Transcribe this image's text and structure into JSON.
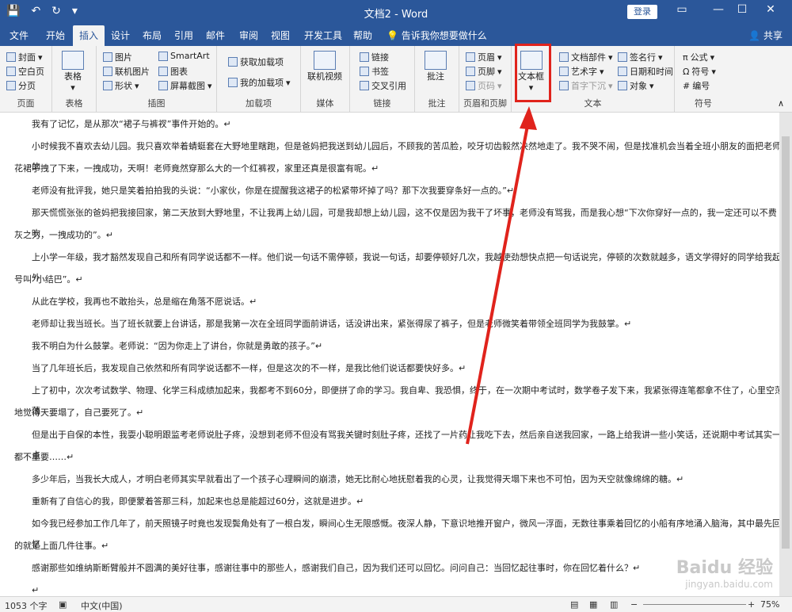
{
  "titlebar": {
    "title": "文档2 - Word",
    "login": "登录",
    "qat": [
      "💾",
      "↶",
      "↻",
      "▾"
    ],
    "min": "—",
    "max": "☐",
    "close": "✕"
  },
  "tabs": [
    "文件",
    "开始",
    "插入",
    "设计",
    "布局",
    "引用",
    "邮件",
    "审阅",
    "视图",
    "开发工具",
    "帮助"
  ],
  "active_tab": "插入",
  "tell_me": "告诉我你想要做什么",
  "share": "共享",
  "ribbon": {
    "pages": {
      "label": "页面",
      "items": [
        "封面",
        "空白页",
        "分页"
      ]
    },
    "tables": {
      "label": "表格",
      "items": [
        "表格"
      ]
    },
    "illustrations": {
      "label": "插图",
      "items": [
        "图片",
        "联机图片",
        "形状",
        "SmartArt",
        "图表",
        "屏幕截图"
      ]
    },
    "addins": {
      "label": "加载项",
      "items": [
        "获取加载项",
        "我的加载项"
      ]
    },
    "media": {
      "label": "媒体",
      "items": [
        "联机视频"
      ]
    },
    "links": {
      "label": "链接",
      "items": [
        "链接",
        "书签",
        "交叉引用"
      ]
    },
    "comments": {
      "label": "批注",
      "items": [
        "批注"
      ]
    },
    "headerfooter": {
      "label": "页眉和页脚",
      "items": [
        "页眉",
        "页脚",
        "页码"
      ]
    },
    "text": {
      "label": "文本",
      "items": [
        "文本框",
        "文档部件",
        "艺术字",
        "首字下沉",
        "签名行",
        "日期和时间",
        "对象"
      ]
    },
    "symbols": {
      "label": "符号",
      "items": [
        "公式",
        "符号",
        "编号"
      ]
    }
  },
  "document": {
    "paragraphs": [
      "我有了记忆，是从那次“裙子与裤衩”事件开始的。↵",
      "小时候我不喜欢去幼儿园。我只喜欢举着蜻蜓套在大野地里瞎跑，但是爸妈把我送到幼儿园后，不顾我的苦瓜脸，咬牙切齿毅然决然地走了。我不哭不闹，但是找准机会当着全班小朋友的面把老师的",
      "花裙子拽了下来，一拽成功，天啊！老师竟然穿那么大的一个红裤衩，家里还真是很富有呢。↵",
      "老师没有批评我，她只是笑着拍拍我的头说：“小家伙，你是在提醒我这裙子的松紧带坏掉了吗？那下次我要穿条好一点的。”↵",
      "那天慌慌张张的爸妈把我接回家，第二天放到大野地里，不让我再上幼儿园，可是我却想上幼儿园，这不仅是因为我干了坏事，老师没有骂我，而是我心想“下次你穿好一点的，我一定还可以不费吹",
      "灰之力，一拽成功的”。↵",
      "上小学一年级，我才豁然发现自己和所有同学说话都不一样。他们说一句话不需停顿，我说一句话，却要停顿好几次，我越使劲想快点把一句话说完，停顿的次数就越多，语文学得好的同学给我起外",
      "号叫“小结巴”。↵",
      "从此在学校，我再也不敢抬头，总是缩在角落不愿说话。↵",
      "老师却让我当班长。当了班长就要上台讲话，那是我第一次在全班同学面前讲话，话没讲出来，紧张得尿了裤子，但是老师微笑着带领全班同学为我鼓掌。↵",
      "我不明白为什么鼓掌。老师说：“因为你走上了讲台，你就是勇敢的孩子。”↵",
      "当了几年班长后，我发现自己依然和所有同学说话都不一样，但是这次的不一样，是我比他们说话都要快好多。↵",
      "上了初中，次次考试数学、物理、化学三科成绩加起来，我都考不到60分，即便拼了命的学习。我自卑、我恐惧，终于，在一次期中考试时，数学卷子发下来，我紧张得连笔都拿不住了，心里空荡荡",
      "地觉得天要塌了，自己要死了。↵",
      "但是出于自保的本性，我耍小聪明跟监考老师说肚子疼，没想到老师不但没有骂我关键时刻肚子疼，还找了一片药让我吃下去，然后亲自送我回家，一路上给我讲一些小笑话，还说期中考试其实一点",
      "都不重要……↵",
      "多少年后，当我长大成人，才明白老师其实早就看出了一个孩子心理瞬间的崩溃，她无比耐心地抚慰着我的心灵，让我觉得天塌下来也不可怕，因为天空就像绵绵的糖。↵",
      "重新有了自信心的我，即便蒙着答那三科，加起来也总是能超过60分，这就是进步。↵",
      "如今我已经参加工作几年了，前天照镜子时竟也发现鬓角处有了一根白发，瞬间心生无限感慨。夜深人静，下意识地推开窗户，微风一浮面，无数往事乘着回忆的小船有序地涌入脑海，其中最先回忆",
      "的就是上面几件往事。↵",
      "感谢那些如维纳斯断臂般并不圆满的美好往事，感谢往事中的那些人，感谢我们自己，因为我们还可以回忆。问问自己：当回忆起往事时，你在回忆着什么？↵",
      "↵"
    ]
  },
  "status": {
    "word_count": "1053 个字",
    "language": "中文(中国)",
    "zoom": "75%"
  },
  "watermark": {
    "brand": "Baidu 经验",
    "url": "jingyan.baidu.com"
  }
}
